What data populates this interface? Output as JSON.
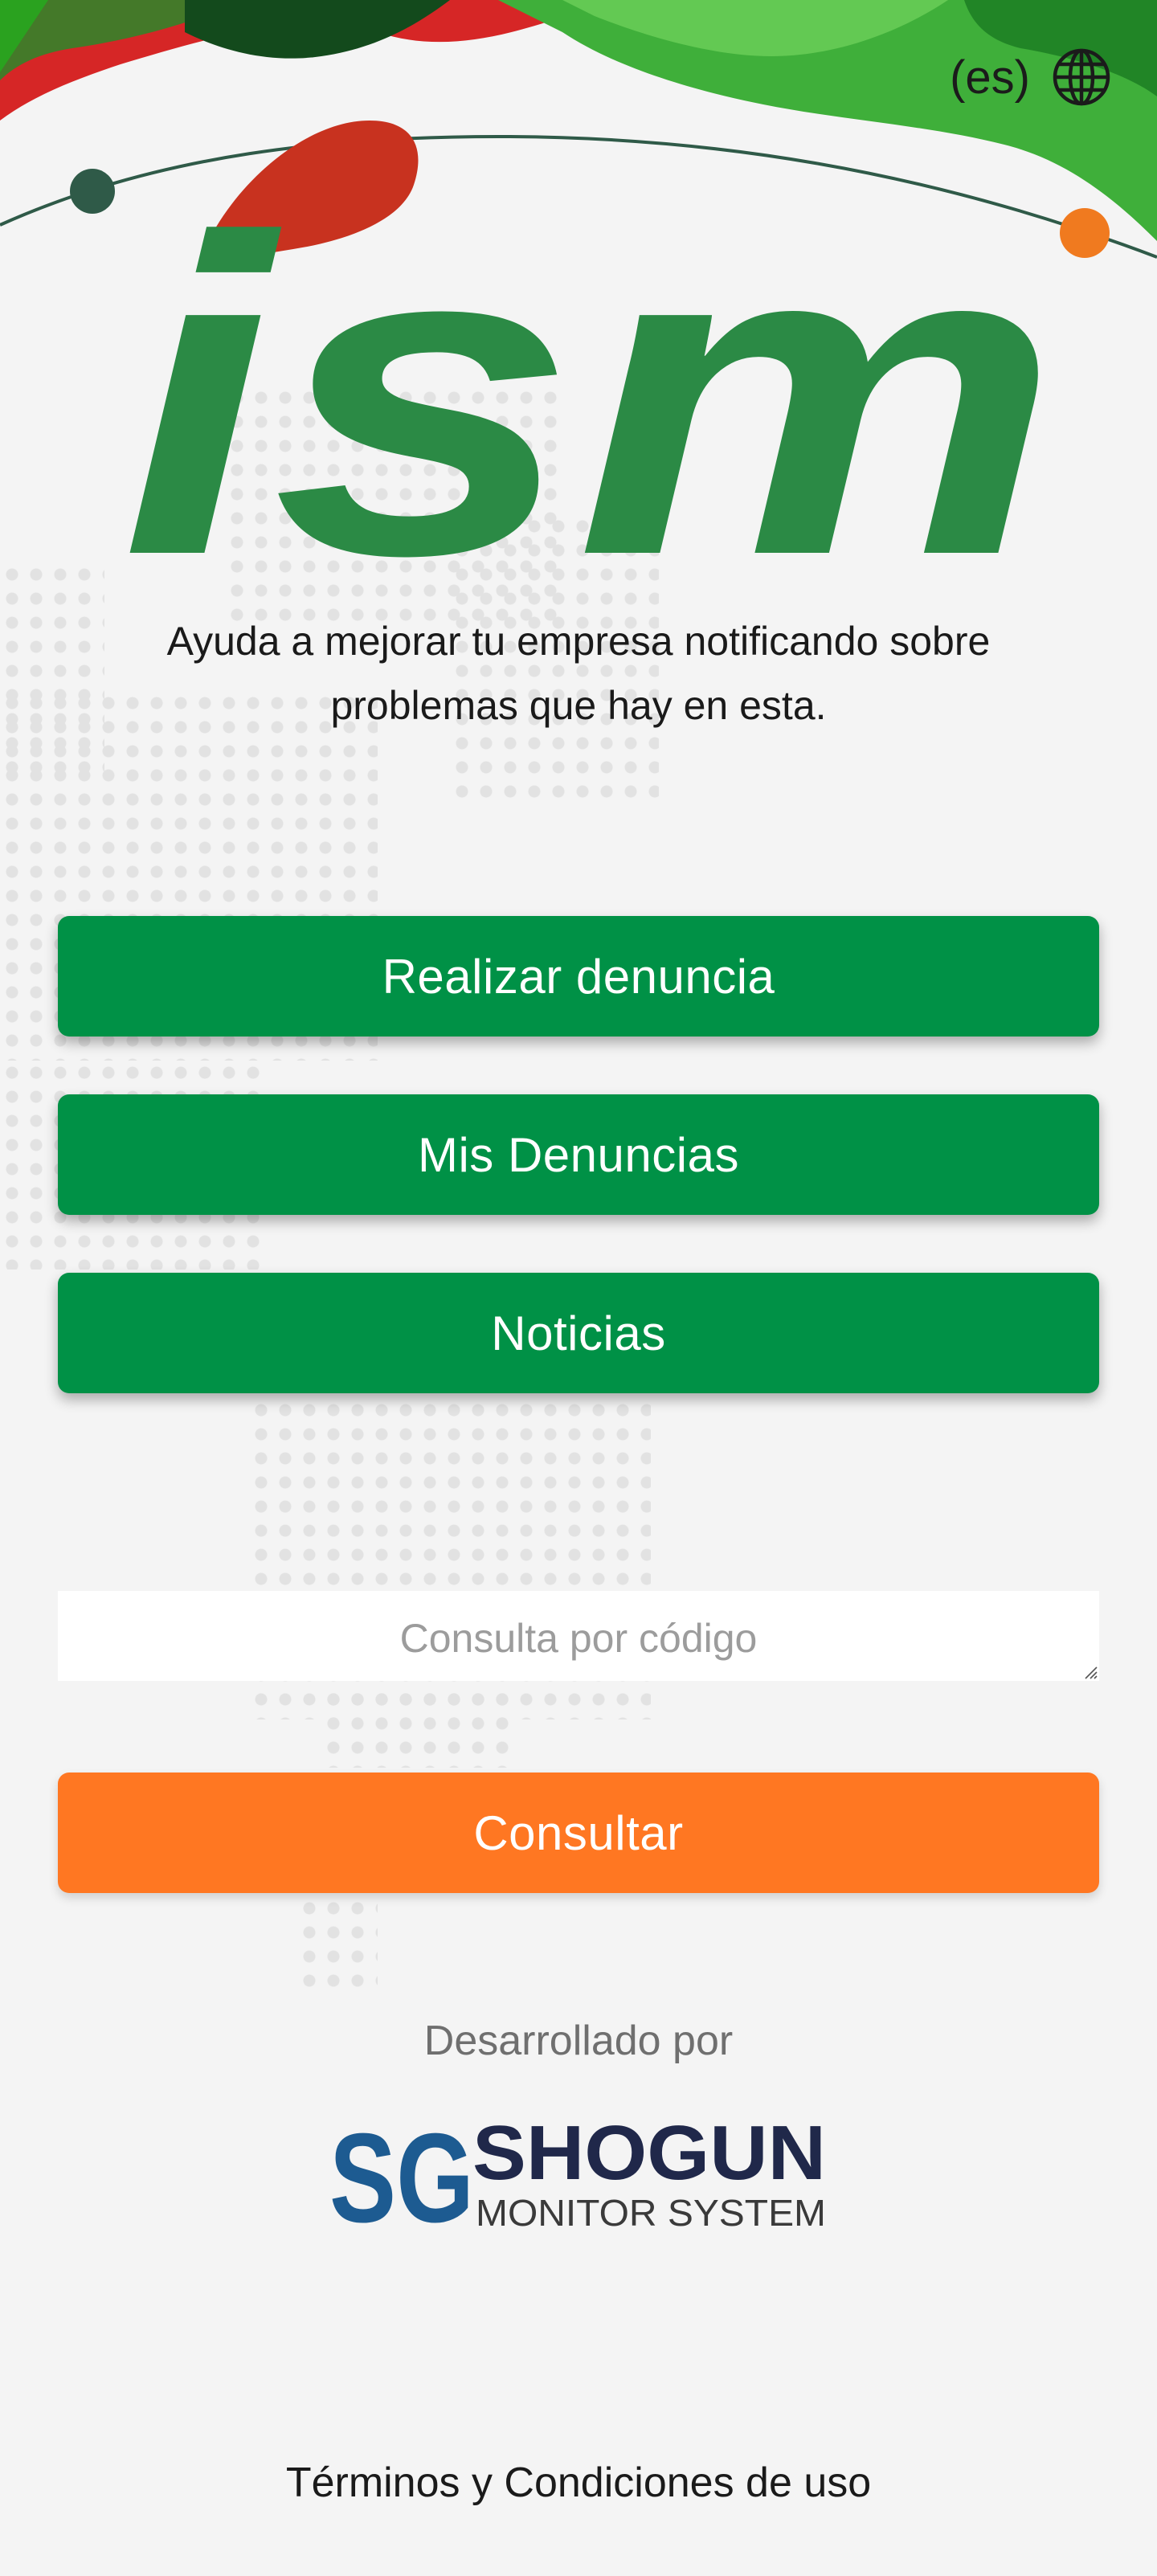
{
  "language": {
    "code": "(es)",
    "icon": "globe-icon"
  },
  "brand": {
    "logo_text": "ism",
    "colors": {
      "green": "#2b8a45",
      "red": "#c8321f",
      "accent_dark": "#2f5a48",
      "accent_orange": "#f07a1f"
    }
  },
  "tagline": "Ayuda a mejorar tu empresa notificando sobre problemas que hay en esta.",
  "actions": {
    "report": "Realizar denuncia",
    "my_reports": "Mis Denuncias",
    "news": "Noticias"
  },
  "lookup": {
    "placeholder": "Consulta por código",
    "value": "",
    "button": "Consultar"
  },
  "footer": {
    "developed_by": "Desarrollado por",
    "developer_logo": {
      "mark": "SG",
      "name": "SHOGUN",
      "subtitle": "MONITOR SYSTEM"
    },
    "terms": "Términos y Condiciones de uso"
  },
  "colors": {
    "primary_button": "#009146",
    "secondary_button": "#ff7722",
    "background": "#f4f4f4"
  }
}
